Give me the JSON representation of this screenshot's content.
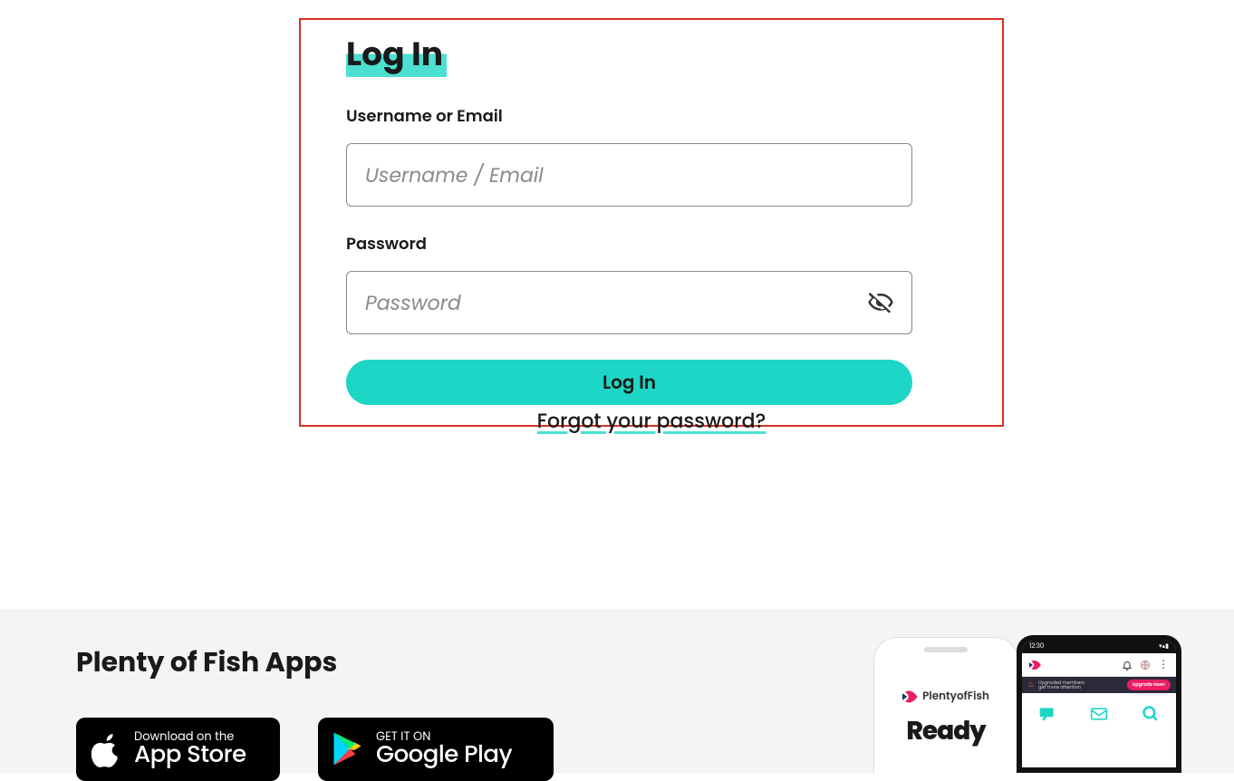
{
  "login": {
    "title": "Log In",
    "username_label": "Username or Email",
    "username_placeholder": "Username / Email",
    "password_label": "Password",
    "password_placeholder": "Password",
    "button_label": "Log In"
  },
  "forgot_link": "Forgot your password?",
  "apps": {
    "title": "Plenty of Fish Apps",
    "appstore_small": "Download on the",
    "appstore_large": "App Store",
    "googleplay_small": "GET IT ON",
    "googleplay_large": "Google Play"
  },
  "mock": {
    "brand": "PlentyofFish",
    "ready": "Ready",
    "time": "12:30",
    "banner_line1": "Upgraded members",
    "banner_line2": "get more attention",
    "upgrade": "Upgrade Now!"
  }
}
